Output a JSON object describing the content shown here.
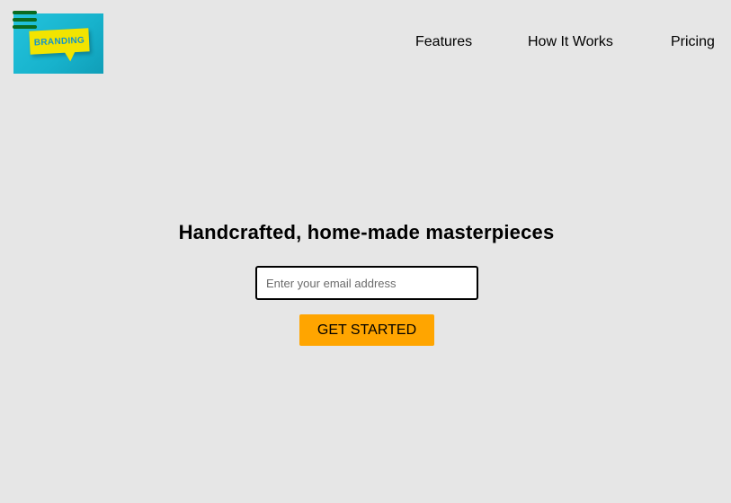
{
  "logo": {
    "text": "BRANDING",
    "colors": {
      "background": "#1fbad3",
      "bubble": "#f2e400",
      "text": "#1495c8"
    }
  },
  "menu": {
    "icon": "hamburger-menu-icon",
    "color": "#0a6b1f"
  },
  "nav": {
    "items": [
      {
        "label": "Features"
      },
      {
        "label": "How It Works"
      },
      {
        "label": "Pricing"
      }
    ]
  },
  "hero": {
    "title": "Handcrafted, home-made masterpieces",
    "email_placeholder": "Enter your email address",
    "cta_label": "GET STARTED"
  },
  "colors": {
    "page_background": "#e6e6e6",
    "cta_background": "#ffa500"
  }
}
